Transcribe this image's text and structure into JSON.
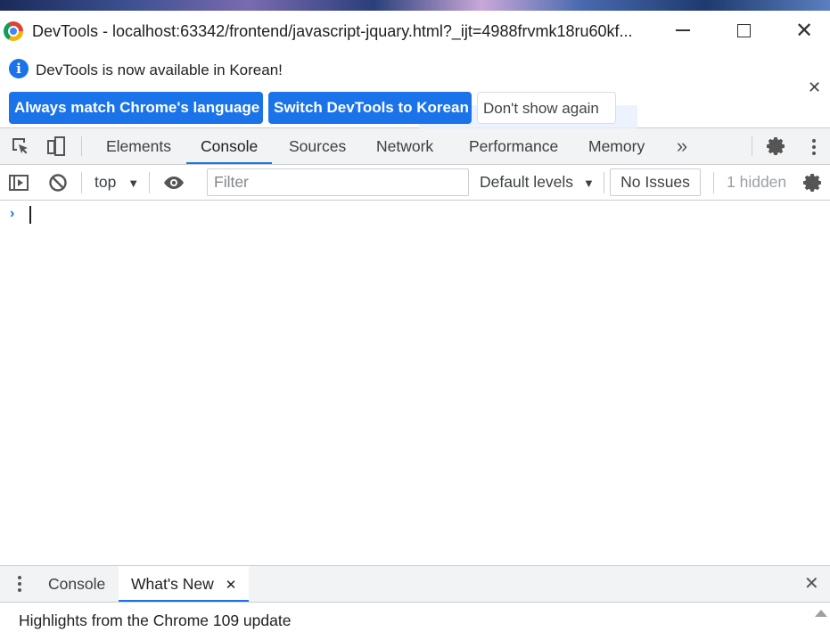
{
  "window": {
    "title": "DevTools - localhost:63342/frontend/javascript-jquary.html?_ijt=4988frvmk18ru60kf...",
    "close_glyph": "✕"
  },
  "infobar": {
    "message": "DevTools is now available in Korean!",
    "info_glyph": "i",
    "buttons": {
      "match_language": "Always match Chrome's language",
      "switch_korean": "Switch DevTools to Korean",
      "dont_show": "Don't show again"
    },
    "close_glyph": "✕"
  },
  "tabs": {
    "items": [
      {
        "label": "Elements"
      },
      {
        "label": "Console"
      },
      {
        "label": "Sources"
      },
      {
        "label": "Network"
      },
      {
        "label": "Performance"
      },
      {
        "label": "Memory"
      }
    ],
    "active": "Console",
    "more_glyph": "»",
    "accent_color": "#1a73e8"
  },
  "console_toolbar": {
    "context": "top",
    "dropdown_glyph": "▼",
    "filter_placeholder": "Filter",
    "levels": "Default levels",
    "issues": "No Issues",
    "hidden": "1 hidden"
  },
  "console": {
    "prompt_glyph": "›"
  },
  "drawer": {
    "tabs": [
      {
        "label": "Console"
      },
      {
        "label": "What's New"
      }
    ],
    "active": "What's New",
    "tab_close_glyph": "✕",
    "close_glyph": "✕",
    "heading": "Highlights from the Chrome 109 update"
  }
}
